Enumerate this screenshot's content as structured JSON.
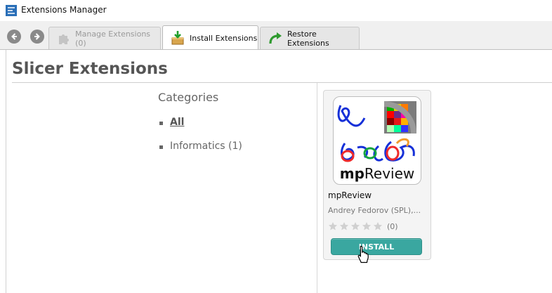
{
  "window": {
    "title": "Extensions Manager"
  },
  "toolbar": {
    "tabs": [
      {
        "label": "Manage Extensions (0)",
        "state": "disabled",
        "icon": "puzzle-icon"
      },
      {
        "label": "Install Extensions",
        "state": "active",
        "icon": "download-box-icon"
      },
      {
        "label": "Restore Extensions",
        "state": "normal",
        "icon": "green-curved-arrow-icon"
      }
    ],
    "back_icon": "back-arrow-icon",
    "forward_icon": "forward-arrow-icon"
  },
  "page": {
    "title": "Slicer Extensions"
  },
  "categories": {
    "heading": "Categories",
    "items": [
      {
        "label": "All",
        "selected": true
      },
      {
        "label": "Informatics (1)",
        "selected": false
      }
    ]
  },
  "extension": {
    "name": "mpReview",
    "author": "Andrey Fedorov (SPL),...",
    "thumbnail_caption": "mpReview",
    "rating_stars": 0,
    "rating_count": "(0)",
    "install_label": "INSTALL",
    "accent_color": "#3aa7a0"
  }
}
